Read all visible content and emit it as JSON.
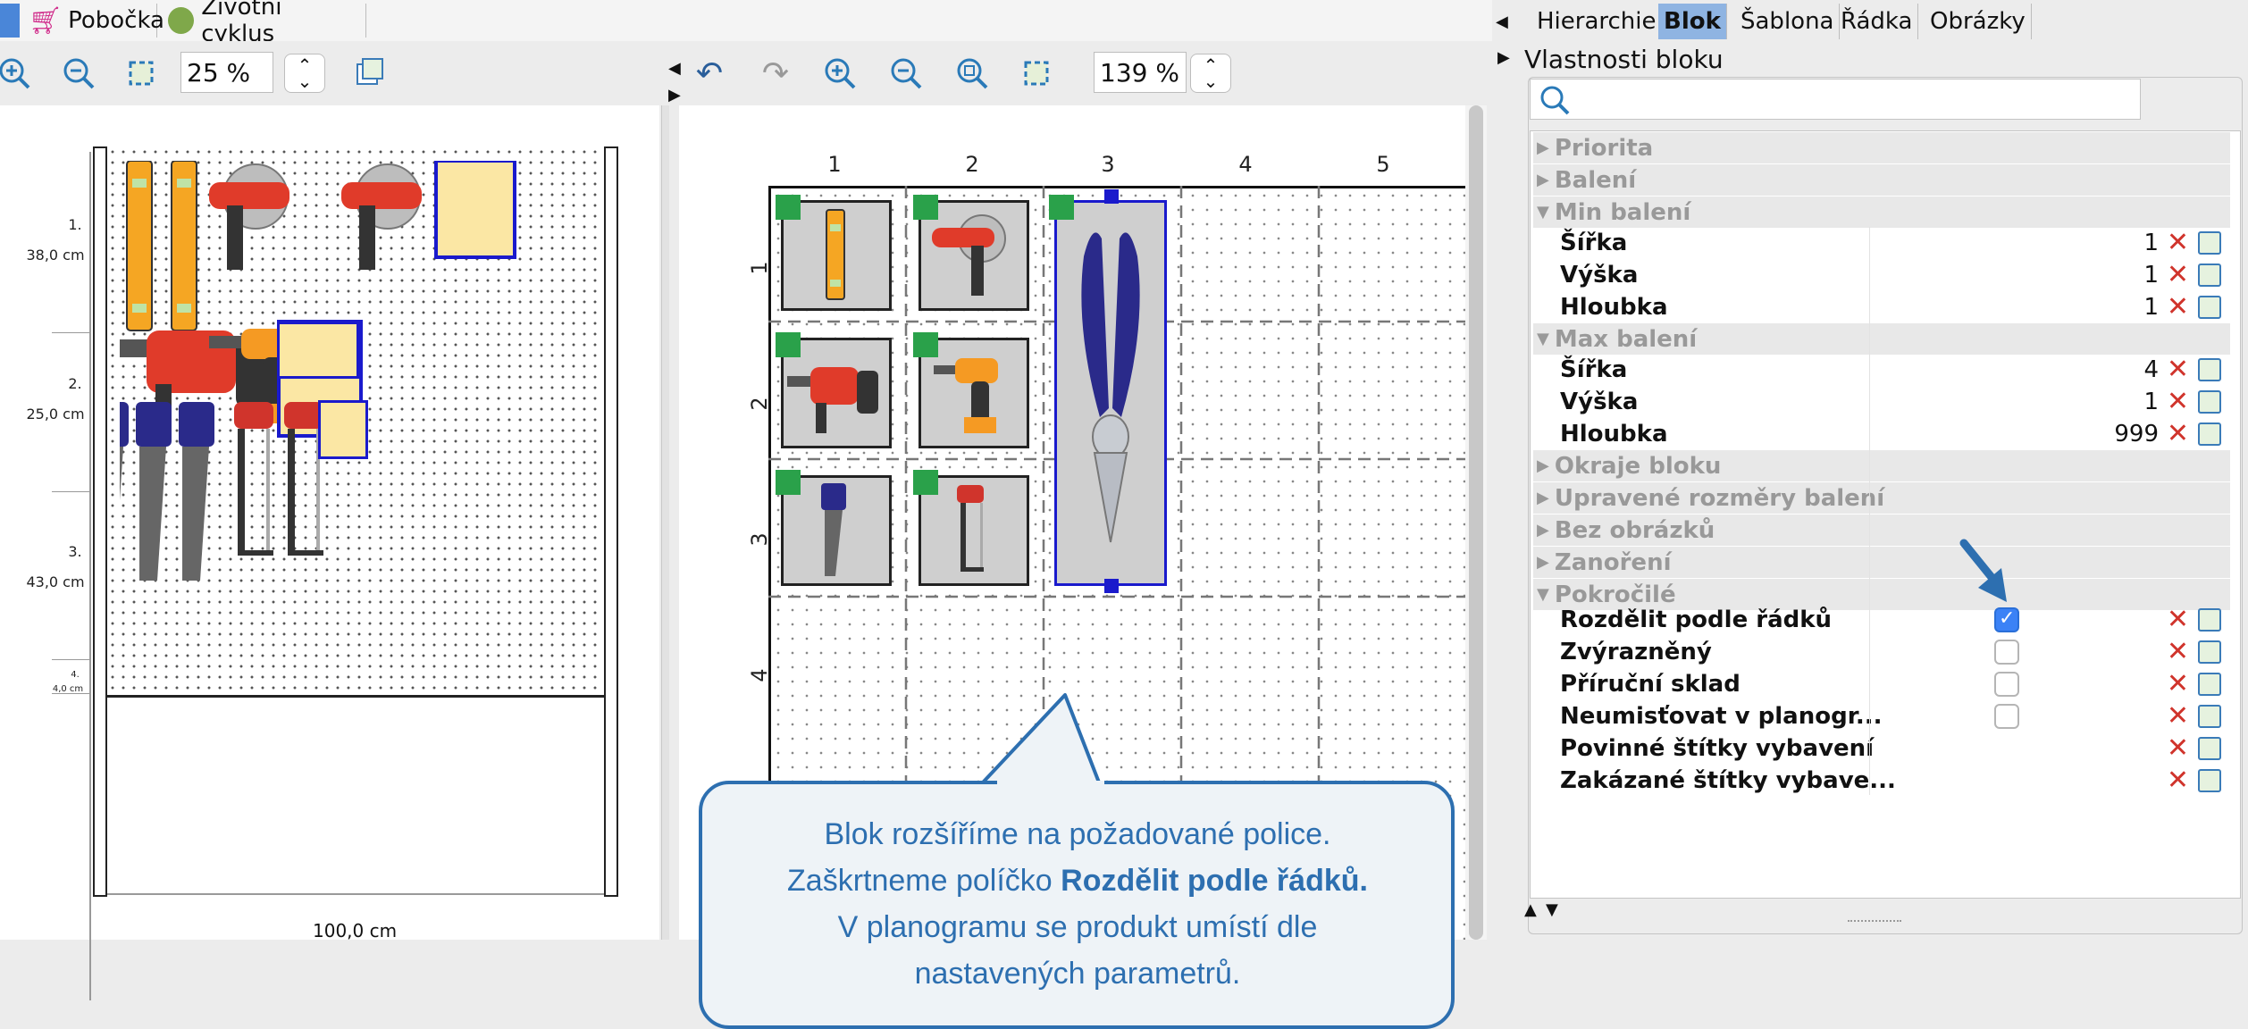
{
  "left_tabs": [
    {
      "label": "Pobočka"
    },
    {
      "label": "Životní cyklus"
    }
  ],
  "left_zoom": "25 %",
  "center_zoom": "139 %",
  "shelves": [
    {
      "num": "1.",
      "height": "38,0 cm"
    },
    {
      "num": "2.",
      "height": "25,0 cm"
    },
    {
      "num": "3.",
      "height": "43,0 cm"
    },
    {
      "num": "4.",
      "height": "4,0 cm"
    }
  ],
  "width_label": "100,0 cm",
  "columns": [
    "1",
    "2",
    "3",
    "4",
    "5"
  ],
  "rows": [
    "1",
    "2",
    "3",
    "4"
  ],
  "right_tabs": [
    {
      "label": "Hierarchie"
    },
    {
      "label": "Blok",
      "active": true
    },
    {
      "label": "Šablona"
    },
    {
      "label": "Řádka"
    },
    {
      "label": "Obrázky"
    }
  ],
  "properties_title": "Vlastnosti bloku",
  "search": {
    "placeholder": ""
  },
  "groups": {
    "priorita": "Priorita",
    "baleni": "Balení",
    "min_baleni": "Min balení",
    "max_baleni": "Max balení",
    "okraje": "Okraje bloku",
    "upravene": "Upravené rozměry balení",
    "bez_obrazku": "Bez obrázků",
    "zanoreni": "Zanoření",
    "pokrocile": "Pokročilé"
  },
  "min_items": [
    {
      "label": "Šířka",
      "value": "1"
    },
    {
      "label": "Výška",
      "value": "1"
    },
    {
      "label": "Hloubka",
      "value": "1"
    }
  ],
  "max_items": [
    {
      "label": "Šířka",
      "value": "4"
    },
    {
      "label": "Výška",
      "value": "1"
    },
    {
      "label": "Hloubka",
      "value": "999"
    }
  ],
  "advanced": [
    {
      "label": "Rozdělit podle řádků",
      "checked": true
    },
    {
      "label": "Zvýrazněný",
      "checked": false
    },
    {
      "label": "Příruční sklad",
      "checked": false
    },
    {
      "label": "Neumisťovat v planogr...",
      "checked": false
    },
    {
      "label": "Povinné štítky vybavení"
    },
    {
      "label": "Zakázané štítky vybave..."
    }
  ],
  "callout": {
    "line1": "Blok rozšíříme na požadované police.",
    "line2_pre": "Zaškrtneme políčko ",
    "line2_bold": "Rozdělit podle řádků.",
    "line3": "V planogramu se produkt umístí dle",
    "line4": "nastavených parametrů."
  },
  "colors": {
    "accent": "#2d6fb0",
    "delete": "#d0342c",
    "selection": "#1a1acc",
    "green": "#2aa14a"
  }
}
